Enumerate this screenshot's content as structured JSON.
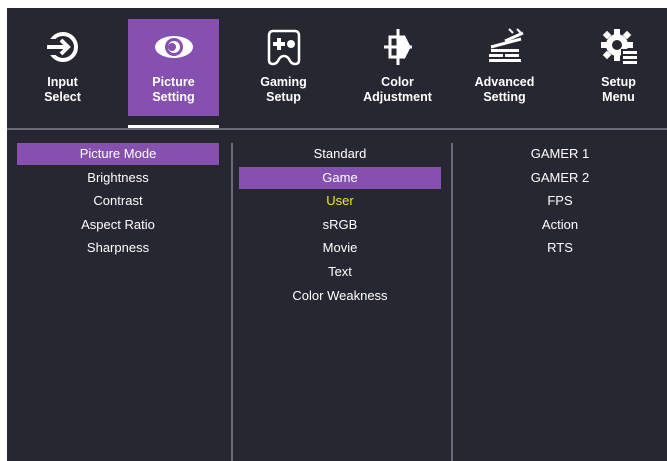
{
  "tabs": [
    {
      "name": "input-select-tab",
      "icon": "input-icon",
      "line1": "Input",
      "line2": "Select",
      "active": false
    },
    {
      "name": "picture-setting-tab",
      "icon": "eye-icon",
      "line1": "Picture",
      "line2": "Setting",
      "active": true
    },
    {
      "name": "gaming-setup-tab",
      "icon": "gamepad-icon",
      "line1": "Gaming",
      "line2": "Setup",
      "active": false
    },
    {
      "name": "color-adjustment-tab",
      "icon": "color-adjust-icon",
      "line1": "Color",
      "line2": "Adjustment",
      "active": false
    },
    {
      "name": "advanced-setting-tab",
      "icon": "advanced-icon",
      "line1": "Advanced",
      "line2": "Setting",
      "active": false
    },
    {
      "name": "setup-menu-tab",
      "icon": "gear-menu-icon",
      "line1": "Setup",
      "line2": "Menu",
      "active": false
    }
  ],
  "picture_menu": {
    "items": [
      "Picture Mode",
      "Brightness",
      "Contrast",
      "Aspect Ratio",
      "Sharpness"
    ],
    "selected": "Picture Mode"
  },
  "picture_mode": {
    "items": [
      "Standard",
      "Game",
      "User",
      "sRGB",
      "Movie",
      "Text",
      "Color Weakness"
    ],
    "highlighted": "Game",
    "current": "User"
  },
  "game_mode": {
    "items": [
      "GAMER 1",
      "GAMER 2",
      "FPS",
      "Action",
      "RTS"
    ]
  },
  "colors": {
    "background": "#272731",
    "accent": "#8550b0",
    "current_value": "#f0e81c",
    "divider": "#6b6b77"
  }
}
